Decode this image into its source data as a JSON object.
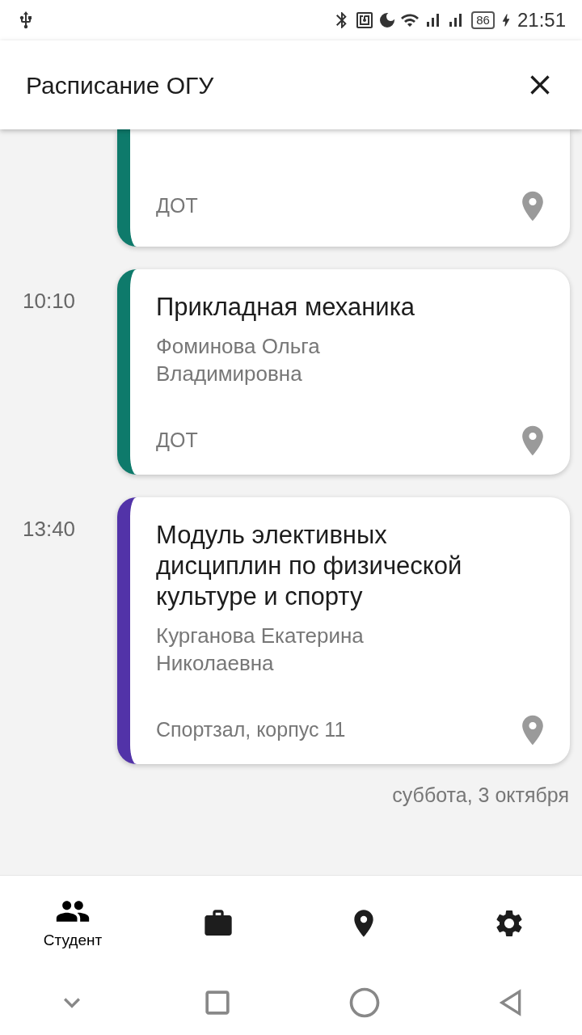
{
  "status_bar": {
    "battery": "86",
    "time": "21:51"
  },
  "header": {
    "title": "Расписание ОГУ"
  },
  "lessons": [
    {
      "place": "ДОТ",
      "color": "#0e7a6b"
    },
    {
      "time": "10:10",
      "title": "Прикладная механика",
      "teacher": "Фоминова Ольга Владимировна",
      "place": "ДОТ",
      "color": "#0e7a6b"
    },
    {
      "time": "13:40",
      "title": "Модуль элективных дисциплин по физической культуре и спорту",
      "teacher": "Курганова Екатерина Николаевна",
      "place": "Спортзал, корпус 11",
      "color": "#5233a8"
    }
  ],
  "next_day": "суббота, 3 октября",
  "nav": [
    {
      "kind": "people",
      "label": "Студент",
      "selected": true
    },
    {
      "kind": "briefcase",
      "selected": false
    },
    {
      "kind": "place",
      "selected": false
    },
    {
      "kind": "settings",
      "selected": false
    }
  ]
}
